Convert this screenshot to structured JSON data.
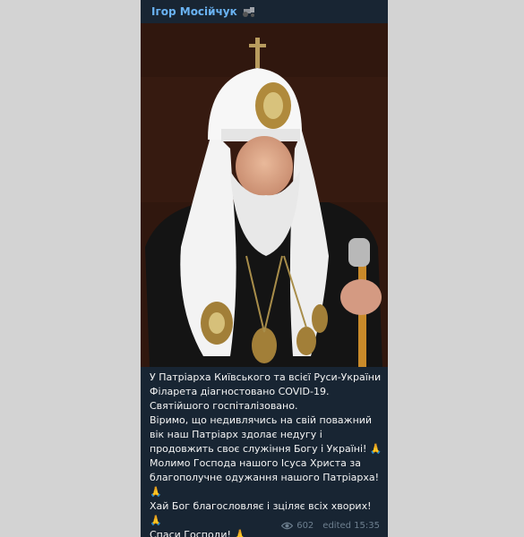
{
  "channel": {
    "name": "Ігор Мосійчук",
    "icon": "tractor-icon"
  },
  "photo": {
    "icon": "patriarch-photo"
  },
  "caption": {
    "line1": "У Патріарха Київського та всієї Руси-України Філарета діагностовано COVID-19.",
    "line2": "Святійшого госпіталізовано.",
    "line3": "Віримо, що недивлячись на свій поважний вік наш Патріарх здолає недугу і продовжить своє служіння Богу і Україні!",
    "line4": "Молимо Господа нашого Ісуса Христа за благополучне одужання нашого Патріарха!",
    "line5": "Хай Бог благословляє і зціляє всіх хворих!",
    "line6": "Спаси Господи!",
    "emoji": "🙏"
  },
  "meta": {
    "views": "602",
    "edited": "edited 15:35",
    "icon": "eye-icon"
  },
  "colors": {
    "background": "#d3d3d3",
    "card": "#182533",
    "accent": "#6ab3f3",
    "meta": "#6d7f8f"
  }
}
